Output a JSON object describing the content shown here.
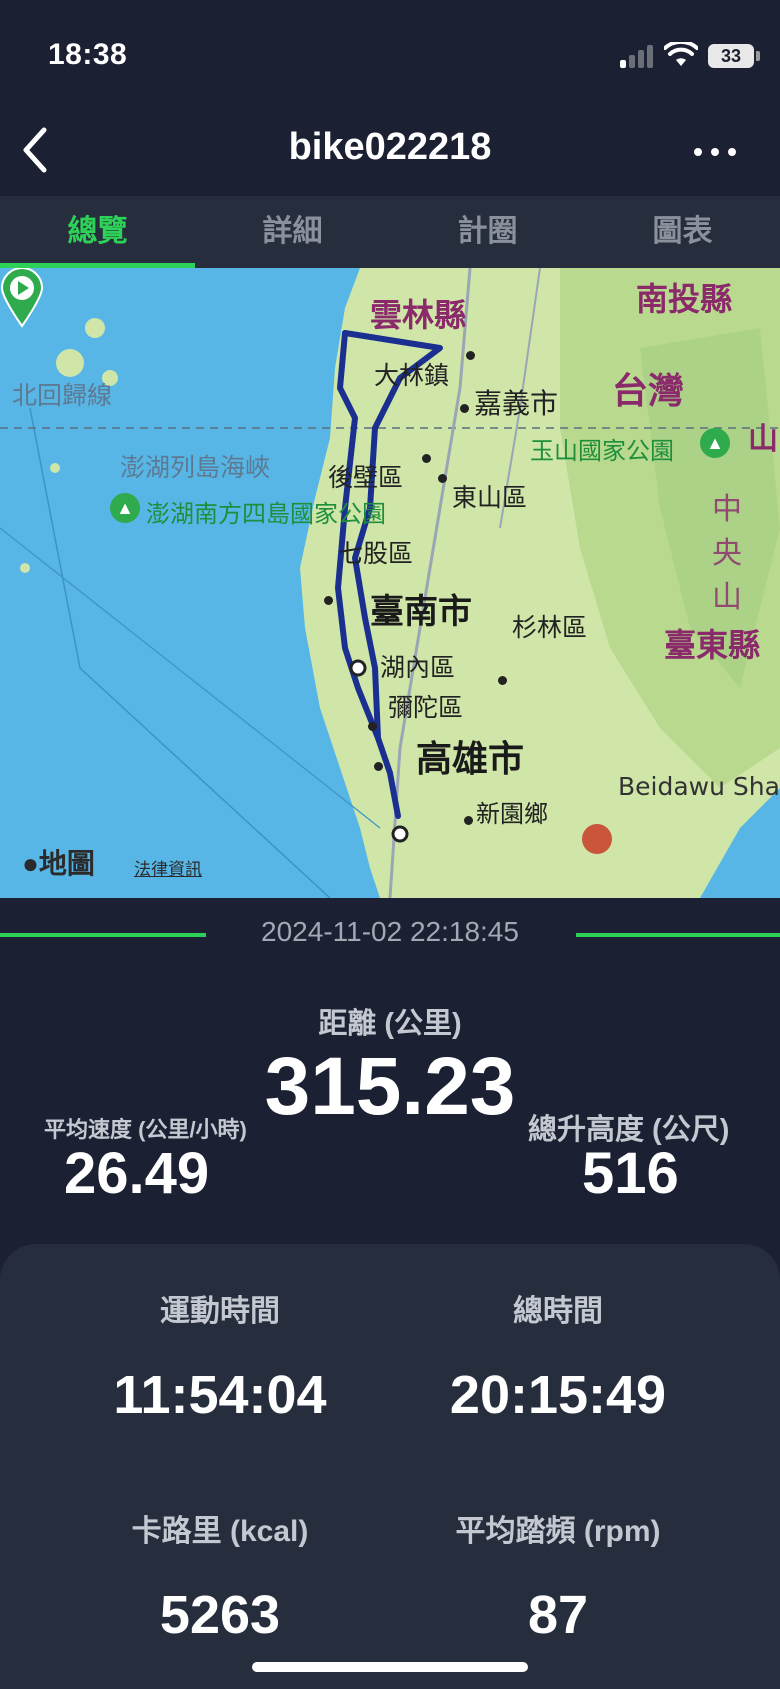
{
  "status_bar": {
    "time": "18:38",
    "battery": "33"
  },
  "nav": {
    "title": "bike022218"
  },
  "tabs": [
    {
      "label": "總覽",
      "active": true
    },
    {
      "label": "詳細",
      "active": false
    },
    {
      "label": "計圈",
      "active": false
    },
    {
      "label": "圖表",
      "active": false
    }
  ],
  "map": {
    "labels": {
      "yunlin": "雲林縣",
      "nantou": "南投縣",
      "taiwan": "台灣",
      "dalin": "大林鎮",
      "chiayi": "嘉義市",
      "tropic": "北回歸線",
      "yushan": "玉山國家公園",
      "penghu_strait": "澎湖列島海峽",
      "houbi": "後壁區",
      "dongshan": "東山區",
      "penghu_park": "澎湖南方四島國家公園",
      "qigu": "七股區",
      "tainan": "臺南市",
      "shanlin": "杉林區",
      "taitung": "臺東縣",
      "hunei": "湖內區",
      "mituo": "彌陀區",
      "kaohsiung": "高雄市",
      "beidawu": "Beidawu Sha",
      "xinyuan": "新園鄉",
      "central_range": "中央山",
      "mountain_char": "山",
      "brand": "地圖",
      "legal": "法律資訊"
    },
    "colors": {
      "sea": "#57b6e6",
      "land": "#cfe6a8",
      "route": "#1a2f8f"
    }
  },
  "session": {
    "datetime": "2024-11-02 22:18:45"
  },
  "stats": {
    "distance": {
      "label": "距離 (公里)",
      "value": "315.23"
    },
    "avg_speed": {
      "label": "平均速度 (公里/小時)",
      "value": "26.49"
    },
    "total_climb": {
      "label": "總升高度 (公尺)",
      "value": "516"
    },
    "moving_time": {
      "label": "運動時間",
      "value": "11:54:04"
    },
    "total_time": {
      "label": "總時間",
      "value": "20:15:49"
    },
    "calories": {
      "label": "卡路里 (kcal)",
      "value": "5263"
    },
    "cadence": {
      "label": "平均踏頻 (rpm)",
      "value": "87"
    }
  },
  "theme": {
    "accent": "#2ed158",
    "background": "#1b2132",
    "card": "#262d3d"
  }
}
